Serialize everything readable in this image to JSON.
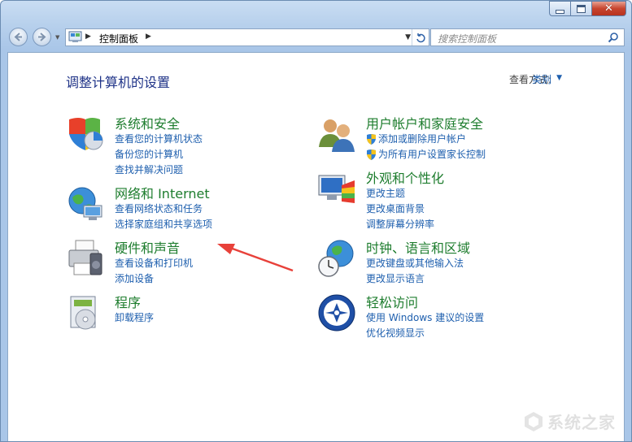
{
  "window": {
    "caption": {
      "minimize": "minimize-icon",
      "maximize": "maximize-icon",
      "close": "close-icon"
    }
  },
  "toolbar": {
    "address": {
      "path": "控制面板"
    },
    "search": {
      "placeholder": "搜索控制面板"
    }
  },
  "main": {
    "title": "调整计算机的设置",
    "view_by_label": "查看方式:",
    "view_by_value": "类别"
  },
  "categories": {
    "system": {
      "title": "系统和安全",
      "links": [
        "查看您的计算机状态",
        "备份您的计算机",
        "查找并解决问题"
      ]
    },
    "network": {
      "title": "网络和 Internet",
      "links": [
        "查看网络状态和任务",
        "选择家庭组和共享选项"
      ]
    },
    "hardware": {
      "title": "硬件和声音",
      "links": [
        "查看设备和打印机",
        "添加设备"
      ]
    },
    "programs": {
      "title": "程序",
      "links": [
        "卸载程序"
      ]
    },
    "users": {
      "title": "用户帐户和家庭安全",
      "links": [
        "添加或删除用户帐户",
        "为所有用户设置家长控制"
      ]
    },
    "appearance": {
      "title": "外观和个性化",
      "links": [
        "更改主题",
        "更改桌面背景",
        "调整屏幕分辨率"
      ]
    },
    "clock": {
      "title": "时钟、语言和区域",
      "links": [
        "更改键盘或其他输入法",
        "更改显示语言"
      ]
    },
    "ease": {
      "title": "轻松访问",
      "links": [
        "使用 Windows 建议的设置",
        "优化视频显示"
      ]
    }
  },
  "watermark": {
    "text": "系统之家"
  },
  "colors": {
    "link": "#1e5fae",
    "category_title": "#1e7d2e",
    "page_title": "#1e3287",
    "arrow": "#e8413a"
  }
}
